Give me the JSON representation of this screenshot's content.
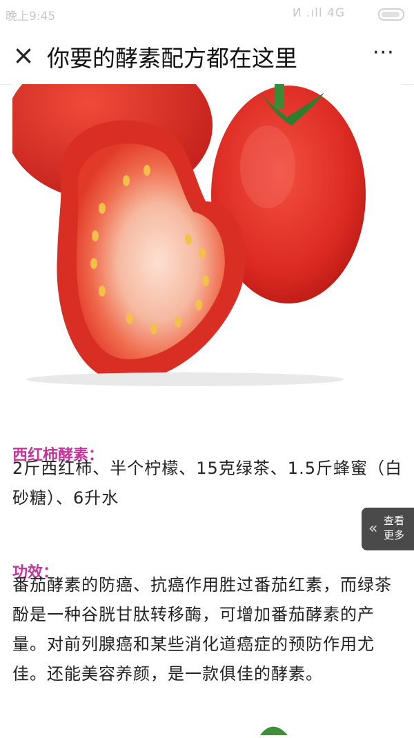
{
  "status_bar": {
    "time": "晚上9:45",
    "network": "ⵍ .ıll 4G"
  },
  "nav": {
    "title": "你要的酵素配方都在这里",
    "close_glyph": "×",
    "more_glyph": "···"
  },
  "recipe": {
    "heading": "西红柿酵素：",
    "ingredients": "2斤西红柿、半个柠檬、15克绿茶、1.5斤蜂蜜（白砂糖）、6升水"
  },
  "benefit": {
    "heading": "功效：",
    "text": "番茄酵素的防癌、抗癌作用胜过番茄红素，而绿茶酚是一种谷胱甘肽转移酶，可增加番茄酵素的产量。对前列腺癌和某些消化道癌症的预防作用尤佳。还能美容养颜，是一款俱佳的酵素。"
  },
  "see_more": {
    "chevron": "«",
    "label": "查看更多"
  },
  "colors": {
    "heading": "#c2359c",
    "tomato": "#e0302a",
    "stem": "#2f7d2f"
  },
  "icons": [
    "close-icon",
    "more-icon",
    "chevron-left-icon",
    "battery-icon"
  ]
}
